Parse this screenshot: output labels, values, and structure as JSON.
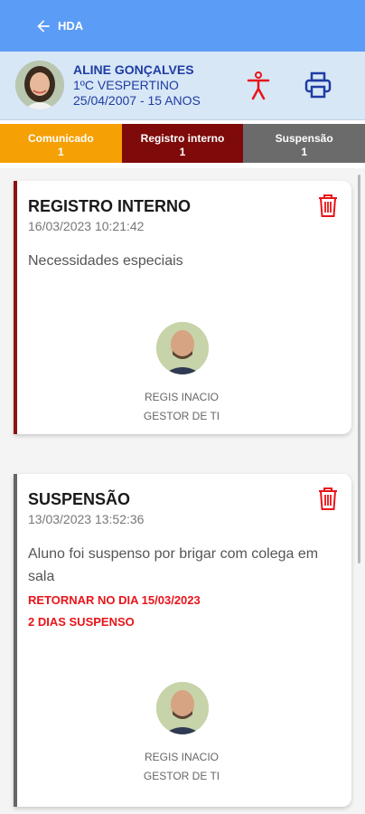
{
  "header": {
    "back_label": "HDA"
  },
  "student": {
    "name": "ALINE GONÇALVES",
    "class": "1ºC VESPERTINO",
    "birth": "25/04/2007 - 15 ANOS"
  },
  "tabs": [
    {
      "label": "Comunicado",
      "count": "1",
      "color": "#f5a005"
    },
    {
      "label": "Registro interno",
      "count": "1",
      "color": "#7e0a0a"
    },
    {
      "label": "Suspensão",
      "count": "1",
      "color": "#6b6b6b"
    }
  ],
  "records": [
    {
      "title": "REGISTRO INTERNO",
      "datetime": "16/03/2023 10:21:42",
      "description": "Necessidades especiais",
      "author_name": "REGIS INACIO",
      "author_role": "GESTOR DE TI",
      "accent_color": "#8b1212"
    },
    {
      "title": "SUSPENSÃO",
      "datetime": "13/03/2023 13:52:36",
      "description": "Aluno foi suspenso por brigar com colega em sala",
      "alert_return": "RETORNAR NO DIA 15/03/2023",
      "alert_days": "2 DIAS SUSPENSO",
      "author_name": "REGIS INACIO",
      "author_role": "GESTOR DE TI",
      "accent_color": "#666666"
    }
  ],
  "icons": {
    "back": "arrow-left-icon",
    "accessibility": "accessibility-icon",
    "print": "printer-icon",
    "delete": "trash-icon"
  },
  "colors": {
    "topbar": "#5b9cf6",
    "student_bg": "#d7e7f6",
    "student_text": "#1f3ca3",
    "alert": "#e8141a",
    "icon_red": "#e8141a"
  }
}
